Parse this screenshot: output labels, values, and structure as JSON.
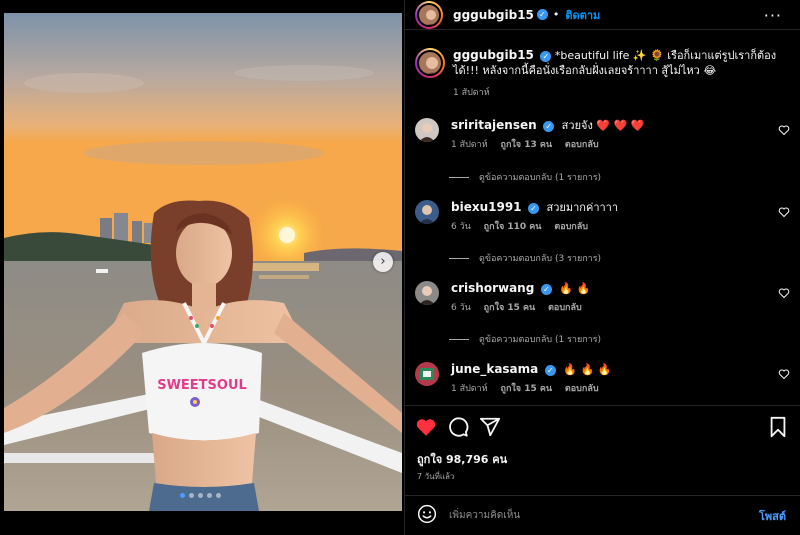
{
  "post": {
    "username": "gggubgib15",
    "follow_label": "ติดตาม",
    "more_label": "···",
    "caption_text": "*beautiful life ✨ 🌻 เรือก็เมาแต่รูปเราก็ต้องได้!!! หลังจากนี้คือนั่งเรือกลับฝั่งเลยจร้าาาา สู้ไม่ไหว 😂",
    "caption_time": "1 สัปดาห์"
  },
  "comments": [
    {
      "username": "sriritajensen",
      "text": "สวยจัง ❤️ ❤️ ❤️",
      "time": "1 สัปดาห์",
      "likes": "ถูกใจ 13 คน",
      "reply": "ตอบกลับ",
      "view_replies": "ดูข้อความตอบกลับ (1 รายการ)"
    },
    {
      "username": "biexu1991",
      "text": "สวยมากค่าาาา",
      "time": "6 วัน",
      "likes": "ถูกใจ 110 คน",
      "reply": "ตอบกลับ",
      "view_replies": "ดูข้อความตอบกลับ (3 รายการ)"
    },
    {
      "username": "crishorwang",
      "text": "🔥 🔥",
      "time": "6 วัน",
      "likes": "ถูกใจ 15 คน",
      "reply": "ตอบกลับ",
      "view_replies": "ดูข้อความตอบกลับ (1 รายการ)"
    },
    {
      "username": "june_kasama",
      "text": "🔥 🔥 🔥",
      "time": "1 สัปดาห์",
      "likes": "ถูกใจ 15 คน",
      "reply": "ตอบกลับ",
      "view_replies": ""
    }
  ],
  "stats": {
    "likes": "ถูกใจ 98,796 คน",
    "time_ago": "7 วันที่แล้ว"
  },
  "composer": {
    "placeholder": "เพิ่มความคิดเห็น",
    "post_label": "โพสต์"
  },
  "media": {
    "shirt_print": "SWEETSOUL",
    "carousel_count": 5,
    "carousel_active_index": 0
  },
  "icons": {
    "like": "heart-icon",
    "comment": "comment-icon",
    "share": "send-icon",
    "save": "bookmark-icon",
    "emoji": "emoji-icon",
    "next": "chevron-right-icon",
    "more": "more-icon",
    "verified": "verified-badge-icon"
  },
  "colors": {
    "accent": "#0095f6",
    "like_red": "#ff3040",
    "background": "#000000"
  }
}
